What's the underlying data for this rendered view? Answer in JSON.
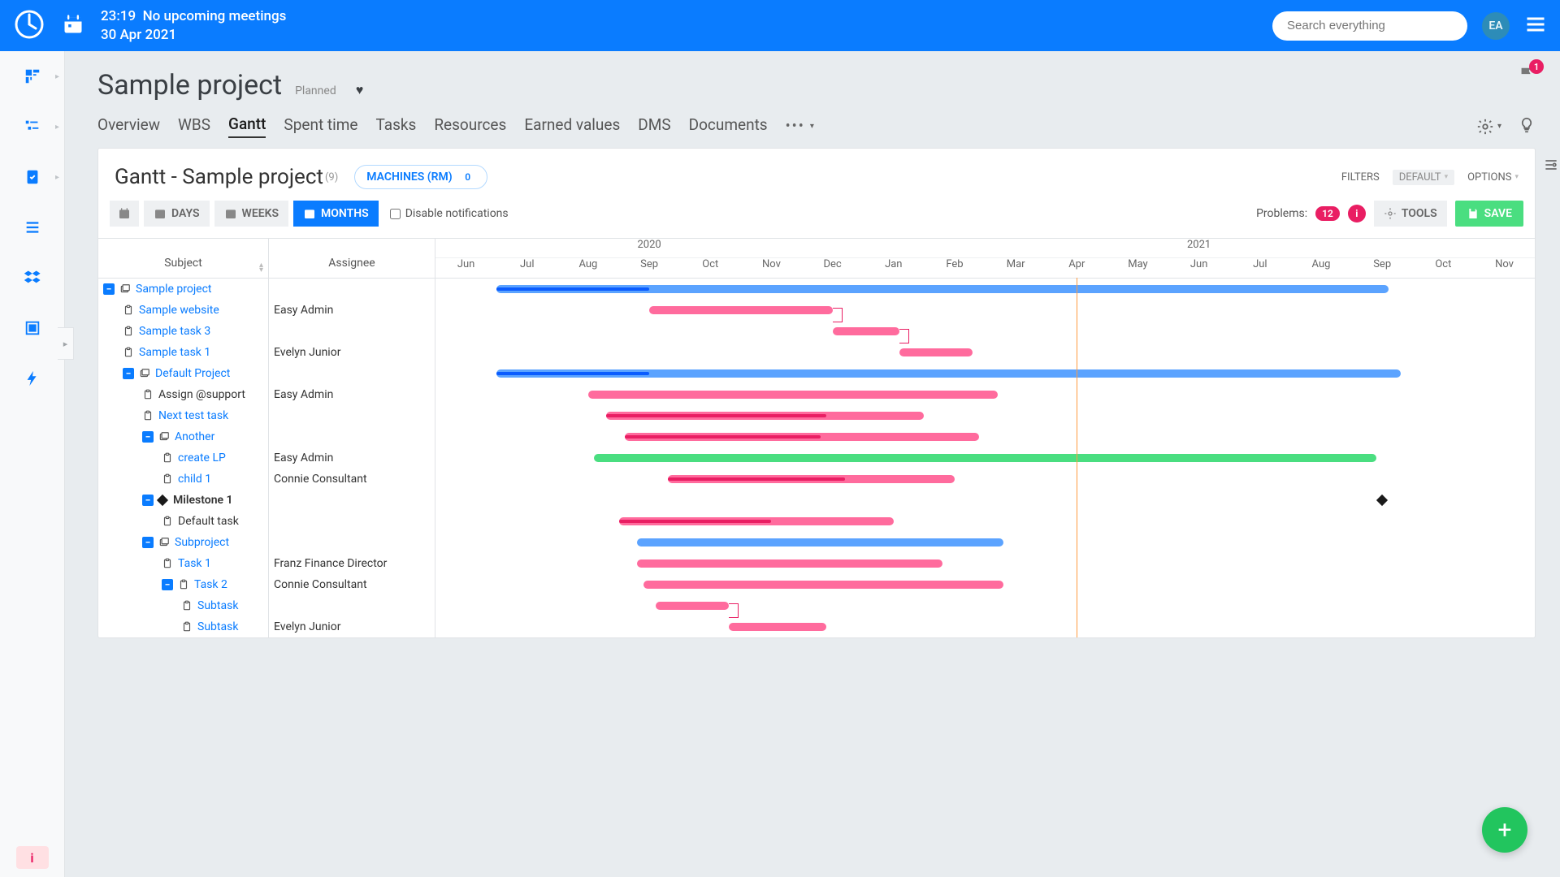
{
  "topbar": {
    "time": "23:19",
    "meetings": "No upcoming meetings",
    "date": "30 Apr 2021",
    "search_placeholder": "Search everything",
    "avatar_initials": "EA"
  },
  "header": {
    "title": "Sample project",
    "status": "Planned",
    "flag_count": "1"
  },
  "tabs": {
    "items": [
      "Overview",
      "WBS",
      "Gantt",
      "Spent time",
      "Tasks",
      "Resources",
      "Earned values",
      "DMS",
      "Documents"
    ],
    "active_index": 2
  },
  "panel": {
    "title": "Gantt - Sample project",
    "count": "(9)",
    "machines_label": "MACHINES (RM)",
    "machines_count": "0",
    "filters_label": "FILTERS",
    "filters_value": "DEFAULT",
    "options_label": "OPTIONS"
  },
  "toolbar": {
    "days": "DAYS",
    "weeks": "WEEKS",
    "months": "MONTHS",
    "disable_notifications": "Disable notifications",
    "problems_label": "Problems:",
    "problems_count": "12",
    "info_icon": "i",
    "tools": "TOOLS",
    "save": "SAVE"
  },
  "columns": {
    "subject": "Subject",
    "assignee": "Assignee"
  },
  "timeline": {
    "years": [
      {
        "label": "2020",
        "span": 7
      },
      {
        "label": "2021",
        "span": 11
      }
    ],
    "months": [
      "Jun",
      "Jul",
      "Aug",
      "Sep",
      "Oct",
      "Nov",
      "Dec",
      "Jan",
      "Feb",
      "Mar",
      "Apr",
      "May",
      "Jun",
      "Jul",
      "Aug",
      "Sep",
      "Oct",
      "Nov"
    ],
    "today_month_index": 10.5
  },
  "rows": [
    {
      "indent": 0,
      "toggle": true,
      "icon": "folder",
      "label": "Sample project",
      "link": true,
      "assignee": "",
      "bar": {
        "type": "blue",
        "start": 1,
        "end": 15.6,
        "inner_end": 3.5
      }
    },
    {
      "indent": 1,
      "icon": "task",
      "label": "Sample website",
      "link": true,
      "assignee": "Easy Admin",
      "bar": {
        "type": "pink",
        "start": 3.5,
        "end": 6.5
      },
      "dep_out": true
    },
    {
      "indent": 1,
      "icon": "task",
      "label": "Sample task 3",
      "link": true,
      "assignee": "",
      "bar": {
        "type": "pink",
        "start": 6.5,
        "end": 7.6
      },
      "dep_out": true
    },
    {
      "indent": 1,
      "icon": "task",
      "label": "Sample task 1",
      "link": true,
      "assignee": "Evelyn Junior",
      "bar": {
        "type": "pink",
        "start": 7.6,
        "end": 8.8
      }
    },
    {
      "indent": 1,
      "toggle": true,
      "icon": "folder",
      "label": "Default Project",
      "link": true,
      "assignee": "",
      "bar": {
        "type": "blue",
        "start": 1,
        "end": 15.8,
        "inner_end": 3.5
      }
    },
    {
      "indent": 2,
      "icon": "task",
      "label": "Assign @support",
      "link": false,
      "assignee": "Easy Admin",
      "bar": {
        "type": "pink",
        "start": 2.5,
        "end": 9.2
      }
    },
    {
      "indent": 2,
      "icon": "task",
      "label": "Next test task",
      "link": true,
      "assignee": "",
      "bar": {
        "type": "pink",
        "start": 2.8,
        "end": 8.0,
        "inner_end": 6.4
      }
    },
    {
      "indent": 2,
      "toggle": true,
      "icon": "folder",
      "label": "Another",
      "link": true,
      "assignee": "",
      "bar": {
        "type": "pink",
        "start": 3.1,
        "end": 8.9,
        "inner_end": 6.3
      }
    },
    {
      "indent": 3,
      "icon": "task",
      "label": "create LP",
      "link": true,
      "assignee": "Easy Admin",
      "bar": {
        "type": "green",
        "start": 2.6,
        "end": 15.4
      }
    },
    {
      "indent": 3,
      "icon": "task",
      "label": "child 1",
      "link": true,
      "assignee": "Connie Consultant",
      "bar": {
        "type": "pink",
        "start": 3.8,
        "end": 8.5,
        "inner_end": 6.7
      }
    },
    {
      "indent": 2,
      "toggle": true,
      "icon": "milestone",
      "label": "Milestone 1",
      "link": false,
      "bold": true,
      "assignee": "",
      "milestone_pos": 15.5
    },
    {
      "indent": 3,
      "icon": "task",
      "label": "Default task",
      "link": false,
      "assignee": "",
      "bar": {
        "type": "pink",
        "start": 3.0,
        "end": 7.5,
        "inner_end": 5.5
      }
    },
    {
      "indent": 2,
      "toggle": true,
      "icon": "folder",
      "label": "Subproject",
      "link": true,
      "assignee": "",
      "bar": {
        "type": "blue",
        "start": 3.3,
        "end": 9.3
      }
    },
    {
      "indent": 3,
      "icon": "task",
      "label": "Task 1",
      "link": true,
      "assignee": "Franz Finance Director",
      "bar": {
        "type": "pink",
        "start": 3.3,
        "end": 8.3
      }
    },
    {
      "indent": 3,
      "toggle": true,
      "icon": "task",
      "label": "Task 2",
      "link": true,
      "assignee": "Connie Consultant",
      "bar": {
        "type": "pink",
        "start": 3.4,
        "end": 9.3
      }
    },
    {
      "indent": 4,
      "icon": "task",
      "label": "Subtask",
      "link": true,
      "assignee": "",
      "bar": {
        "type": "pink",
        "start": 3.6,
        "end": 4.8
      },
      "dep_out": true
    },
    {
      "indent": 4,
      "icon": "task",
      "label": "Subtask",
      "link": true,
      "assignee": "Evelyn Junior",
      "bar": {
        "type": "pink",
        "start": 4.8,
        "end": 6.4
      }
    }
  ]
}
